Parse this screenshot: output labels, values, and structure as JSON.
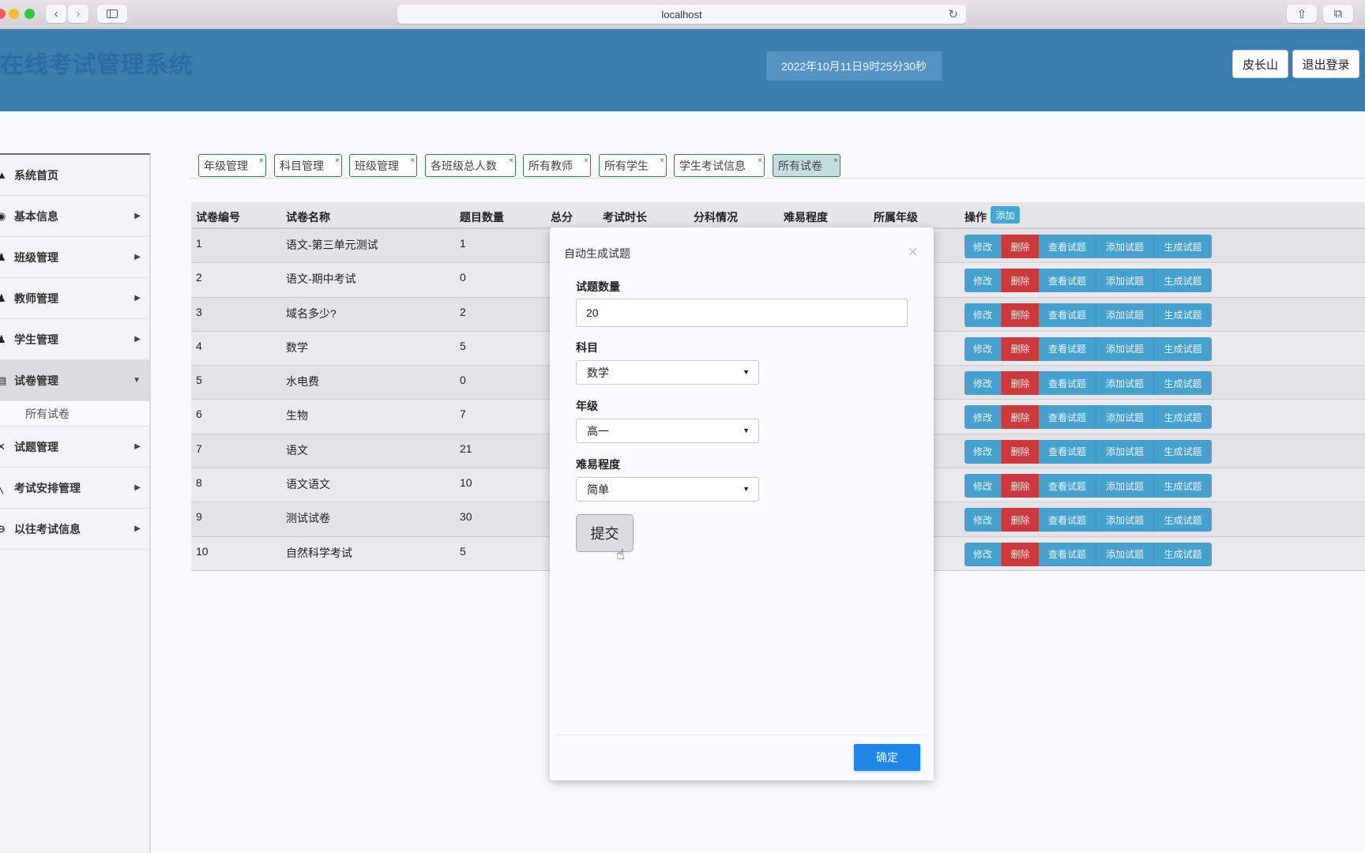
{
  "browser": {
    "url": "localhost",
    "icons": [
      "back-icon",
      "forward-icon",
      "sidebar-icon",
      "reload-icon",
      "share-icon",
      "tabs-icon"
    ]
  },
  "header": {
    "title": "在线考试管理系统",
    "datetime": "2022年10月11日9时25分30秒",
    "user_label": "皮长山",
    "logout_label": "退出登录"
  },
  "sidebar": {
    "items": [
      {
        "label": "系统首页",
        "icon": "home-icon",
        "has_caret": false
      },
      {
        "label": "基本信息",
        "icon": "info-icon",
        "has_caret": true
      },
      {
        "label": "班级管理",
        "icon": "users-icon",
        "has_caret": true
      },
      {
        "label": "教师管理",
        "icon": "teacher-icon",
        "has_caret": true
      },
      {
        "label": "学生管理",
        "icon": "student-icon",
        "has_caret": true
      },
      {
        "label": "试卷管理",
        "icon": "paper-icon",
        "has_caret": true,
        "expanded": true
      },
      {
        "label": "试题管理",
        "icon": "question-icon",
        "has_caret": true
      },
      {
        "label": "考试安排管理",
        "icon": "schedule-icon",
        "has_caret": true
      },
      {
        "label": "以往考试信息",
        "icon": "history-icon",
        "has_caret": true
      }
    ],
    "subitem": "所有试卷"
  },
  "tabs": [
    {
      "label": "年级管理",
      "active": false
    },
    {
      "label": "科目管理",
      "active": false
    },
    {
      "label": "班级管理",
      "active": false
    },
    {
      "label": "各班级总人数",
      "active": false
    },
    {
      "label": "所有教师",
      "active": false
    },
    {
      "label": "所有学生",
      "active": false
    },
    {
      "label": "学生考试信息",
      "active": false
    },
    {
      "label": "所有试卷",
      "active": true
    }
  ],
  "tab_close_glyph": "×",
  "table": {
    "columns": [
      "试卷编号",
      "试卷名称",
      "题目数量",
      "总分",
      "考试时长",
      "分科情况",
      "难易程度",
      "所属年级",
      "操作"
    ],
    "add_label": "添加",
    "actions": [
      "修改",
      "删除",
      "查看试题",
      "添加试题",
      "生成试题"
    ],
    "rows": [
      {
        "id": "1",
        "name": "语文-第三单元测试",
        "count": "1"
      },
      {
        "id": "2",
        "name": "语文-期中考试",
        "count": "0"
      },
      {
        "id": "3",
        "name": "域名多少?",
        "count": "2"
      },
      {
        "id": "4",
        "name": "数学",
        "count": "5"
      },
      {
        "id": "5",
        "name": "水电费",
        "count": "0"
      },
      {
        "id": "6",
        "name": "生物",
        "count": "7"
      },
      {
        "id": "7",
        "name": "语文",
        "count": "21"
      },
      {
        "id": "8",
        "name": "语文语文",
        "count": "10"
      },
      {
        "id": "9",
        "name": "测试试卷",
        "count": "30"
      },
      {
        "id": "10",
        "name": "自然科学考试",
        "count": "5"
      }
    ]
  },
  "modal": {
    "title": "自动生成试题",
    "close_glyph": "×",
    "fields": {
      "count_label": "试题数量",
      "count_value": "20",
      "subject_label": "科目",
      "subject_value": "数学",
      "grade_label": "年级",
      "grade_value": "高一",
      "difficulty_label": "难易程度",
      "difficulty_value": "简单"
    },
    "submit_label": "提交",
    "confirm_label": "确定"
  },
  "colors": {
    "header": "#3b7dad",
    "primary_action": "#46a1cc",
    "danger": "#c9393d",
    "confirm": "#1f86e6",
    "active_tab": "#c4dde0"
  }
}
